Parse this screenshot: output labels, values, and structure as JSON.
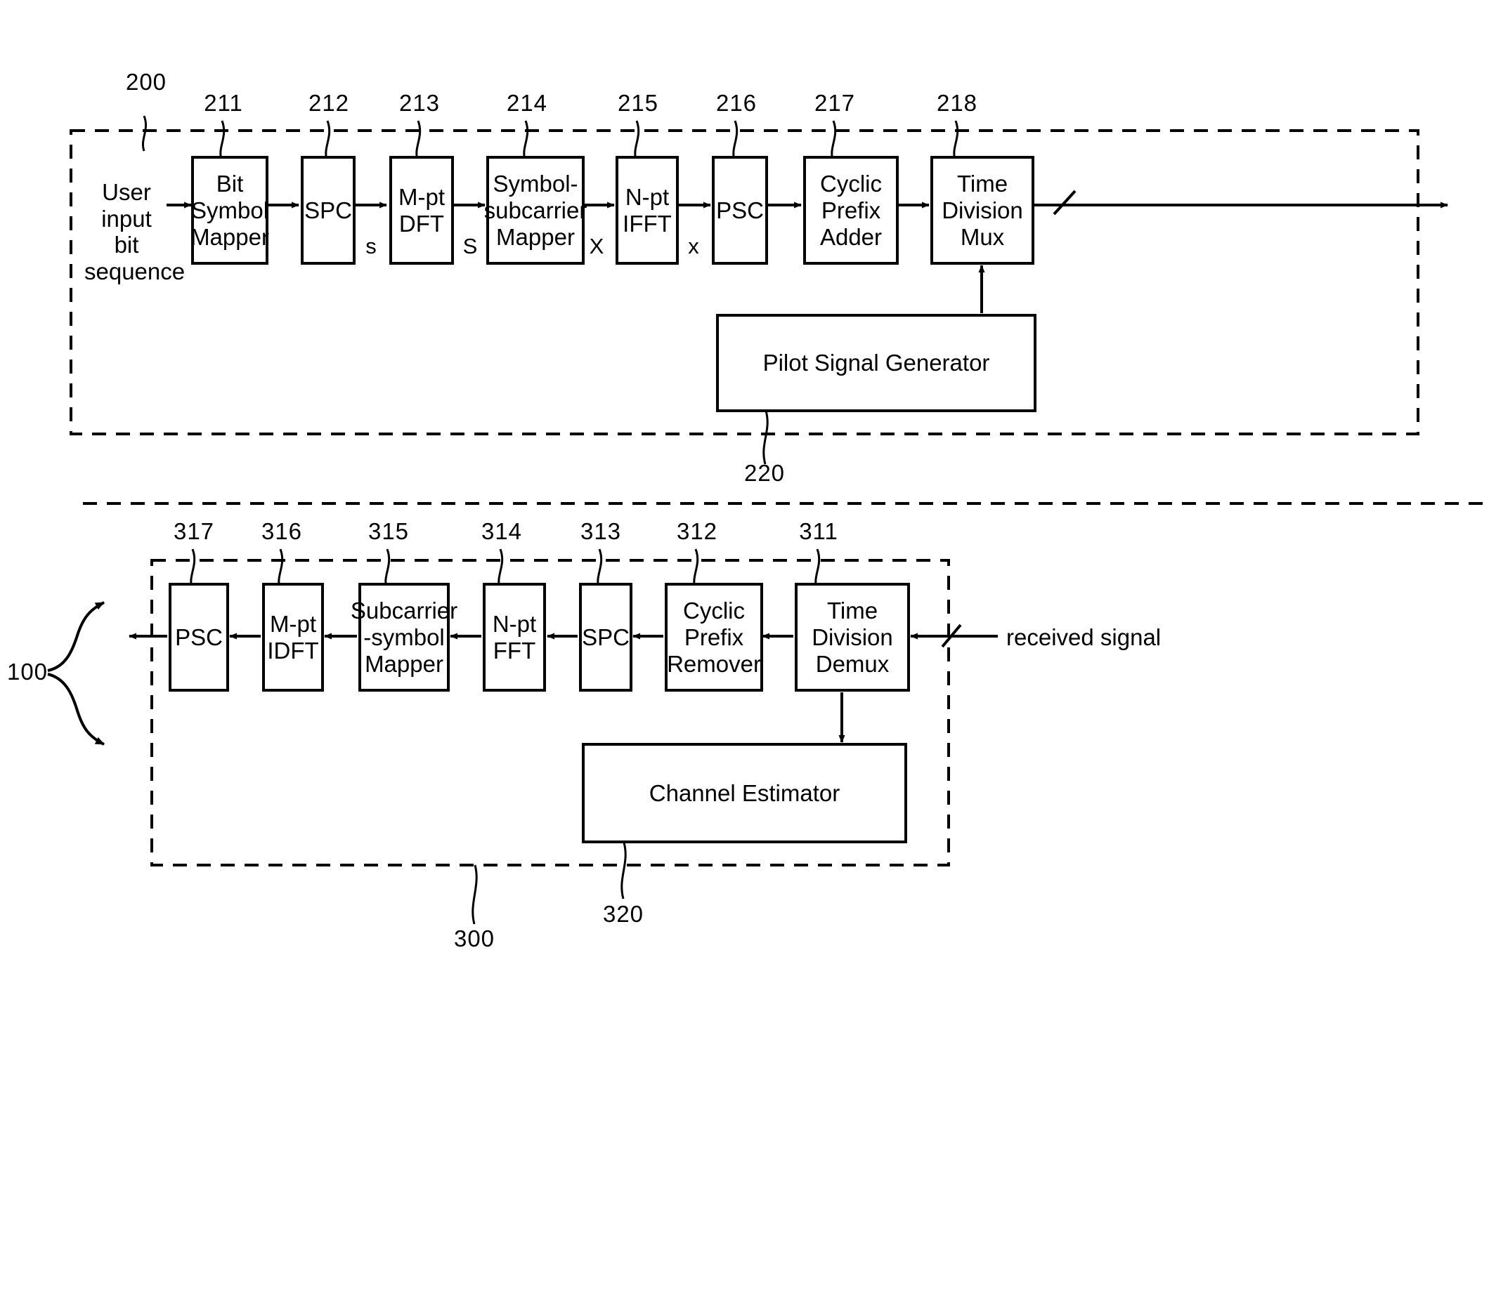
{
  "figure": {
    "system_ref": "100",
    "transmitter": {
      "ref": "200",
      "input_label": "User input\nbit sequence",
      "output_note": "",
      "blocks": [
        {
          "ref": "211",
          "label": "Bit\nSymbol\nMapper"
        },
        {
          "ref": "212",
          "label": "SPC"
        },
        {
          "ref": "213",
          "label": "M-pt\nDFT"
        },
        {
          "ref": "214",
          "label": "Symbol-\nsubcarrier\nMapper"
        },
        {
          "ref": "215",
          "label": "N-pt\nIFFT"
        },
        {
          "ref": "216",
          "label": "PSC"
        },
        {
          "ref": "217",
          "label": "Cyclic\nPrefix\nAdder"
        },
        {
          "ref": "218",
          "label": "Time\nDivision Mux"
        }
      ],
      "signal_labels": [
        "s",
        "S",
        "X",
        "x"
      ],
      "pilot": {
        "ref": "220",
        "label": "Pilot Signal Generator"
      }
    },
    "receiver": {
      "ref": "300",
      "input_label": "received signal",
      "blocks": [
        {
          "ref": "317",
          "label": "PSC"
        },
        {
          "ref": "316",
          "label": "M-pt\nIDFT"
        },
        {
          "ref": "315",
          "label": "Subcarrier\n-symbol\nMapper"
        },
        {
          "ref": "314",
          "label": "N-pt\nFFT"
        },
        {
          "ref": "313",
          "label": "SPC"
        },
        {
          "ref": "312",
          "label": "Cyclic\nPrefix\nRemover"
        },
        {
          "ref": "311",
          "label": "Time Division\nDemux"
        }
      ],
      "estimator": {
        "ref": "320",
        "label": "Channel Estimator"
      }
    }
  },
  "colors": {
    "line": "#000000",
    "background": "#ffffff"
  }
}
